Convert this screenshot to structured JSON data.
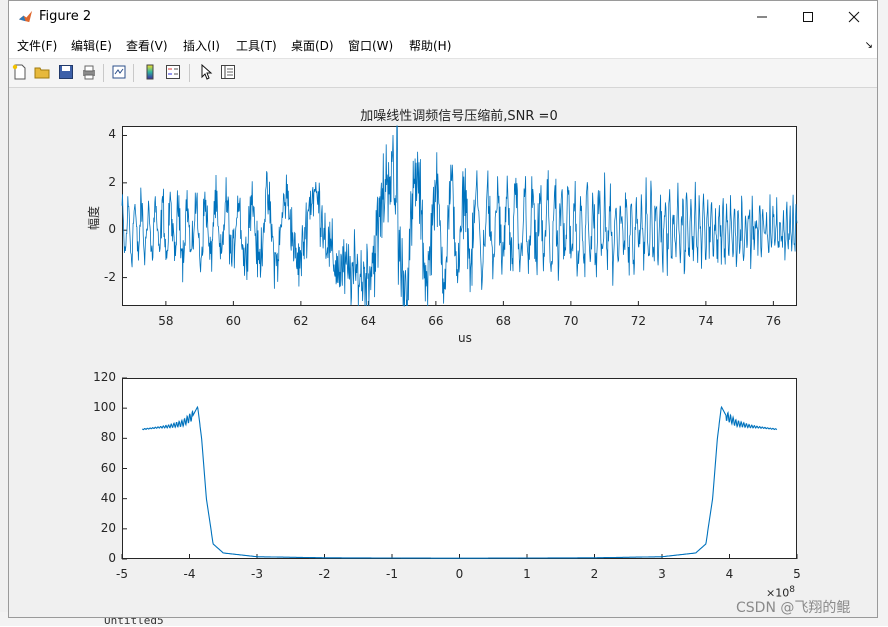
{
  "window": {
    "title": "Figure 2"
  },
  "menu": [
    "文件(F)",
    "编辑(E)",
    "查看(V)",
    "插入(I)",
    "工具(T)",
    "桌面(D)",
    "窗口(W)",
    "帮助(H)"
  ],
  "background_text": {
    "bottom_left": "Untitled5"
  },
  "chart_data": [
    {
      "type": "line",
      "title": "加噪线性调频信号压缩前,SNR =0",
      "xlabel": "us",
      "ylabel": "幅度",
      "xlim": [
        56.7,
        76.7
      ],
      "ylim": [
        -3.2,
        4.4
      ],
      "xticks": [
        58,
        60,
        62,
        64,
        66,
        68,
        70,
        72,
        74,
        76
      ],
      "yticks": [
        -2,
        0,
        2,
        4
      ],
      "series": [
        {
          "color": "#0072BD",
          "description": "noisy chirp amplitude, roughly ±2.5 with peaks near 4.4 at x≈64.8",
          "sampled_envelope": [
            {
              "x": 56.7,
              "amp": 1.6
            },
            {
              "x": 58,
              "amp": 1.8
            },
            {
              "x": 59.5,
              "amp": 2.0
            },
            {
              "x": 60.5,
              "amp": 2.2
            },
            {
              "x": 62,
              "amp": 2.4
            },
            {
              "x": 63.5,
              "amp": 3.0
            },
            {
              "x": 64.8,
              "amp": 4.4
            },
            {
              "x": 66,
              "amp": 3.0
            },
            {
              "x": 68,
              "amp": 2.5
            },
            {
              "x": 70,
              "amp": 2.4
            },
            {
              "x": 72,
              "amp": 2.0
            },
            {
              "x": 74,
              "amp": 1.8
            },
            {
              "x": 76.7,
              "amp": 1.2
            }
          ]
        }
      ]
    },
    {
      "type": "line",
      "title": "",
      "xlabel": "",
      "ylabel": "",
      "xlim": [
        -5,
        5
      ],
      "ylim": [
        0,
        120
      ],
      "x_exponent_label": "×10",
      "x_exponent_power": "8",
      "xticks": [
        -5,
        -4,
        -3,
        -2,
        -1,
        0,
        1,
        2,
        3,
        4,
        5
      ],
      "yticks": [
        0,
        20,
        40,
        60,
        80,
        100,
        120
      ],
      "series": [
        {
          "color": "#0072BD",
          "points": [
            [
              -4.7,
              86
            ],
            [
              -4.5,
              87
            ],
            [
              -4.3,
              88
            ],
            [
              -4.1,
              90
            ],
            [
              -3.95,
              95
            ],
            [
              -3.88,
              101
            ],
            [
              -3.82,
              80
            ],
            [
              -3.75,
              40
            ],
            [
              -3.65,
              10
            ],
            [
              -3.5,
              4
            ],
            [
              -3.0,
              1.5
            ],
            [
              -2.0,
              0.8
            ],
            [
              0.0,
              0.5
            ],
            [
              2.0,
              0.8
            ],
            [
              3.0,
              1.5
            ],
            [
              3.5,
              4
            ],
            [
              3.65,
              10
            ],
            [
              3.75,
              40
            ],
            [
              3.82,
              80
            ],
            [
              3.88,
              101
            ],
            [
              3.95,
              95
            ],
            [
              4.1,
              90
            ],
            [
              4.3,
              88
            ],
            [
              4.5,
              87
            ],
            [
              4.7,
              86
            ]
          ]
        }
      ]
    }
  ],
  "watermark": "CSDN @飞翔的鲲"
}
